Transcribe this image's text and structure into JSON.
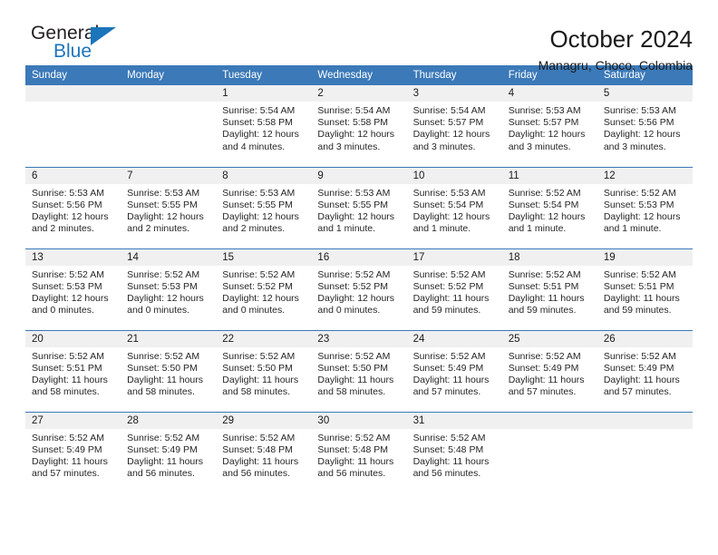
{
  "brand": {
    "word_general": "General",
    "word_blue": "Blue",
    "triangle_color": "#1b75bb"
  },
  "header": {
    "title": "October 2024",
    "subtitle": "Managru, Choco, Colombia",
    "accent_color": "#3b79b8"
  },
  "calendar": {
    "weekday_headers": [
      "Sunday",
      "Monday",
      "Tuesday",
      "Wednesday",
      "Thursday",
      "Friday",
      "Saturday"
    ],
    "labels": {
      "sunrise": "Sunrise:",
      "sunset": "Sunset:",
      "daylight": "Daylight:"
    },
    "weeks": [
      [
        {
          "day": "",
          "sunrise": "",
          "sunset": "",
          "daylight_line1": "",
          "daylight_line2": ""
        },
        {
          "day": "",
          "sunrise": "",
          "sunset": "",
          "daylight_line1": "",
          "daylight_line2": ""
        },
        {
          "day": "1",
          "sunrise": "Sunrise: 5:54 AM",
          "sunset": "Sunset: 5:58 PM",
          "daylight_line1": "Daylight: 12 hours",
          "daylight_line2": "and 4 minutes."
        },
        {
          "day": "2",
          "sunrise": "Sunrise: 5:54 AM",
          "sunset": "Sunset: 5:58 PM",
          "daylight_line1": "Daylight: 12 hours",
          "daylight_line2": "and 3 minutes."
        },
        {
          "day": "3",
          "sunrise": "Sunrise: 5:54 AM",
          "sunset": "Sunset: 5:57 PM",
          "daylight_line1": "Daylight: 12 hours",
          "daylight_line2": "and 3 minutes."
        },
        {
          "day": "4",
          "sunrise": "Sunrise: 5:53 AM",
          "sunset": "Sunset: 5:57 PM",
          "daylight_line1": "Daylight: 12 hours",
          "daylight_line2": "and 3 minutes."
        },
        {
          "day": "5",
          "sunrise": "Sunrise: 5:53 AM",
          "sunset": "Sunset: 5:56 PM",
          "daylight_line1": "Daylight: 12 hours",
          "daylight_line2": "and 3 minutes."
        }
      ],
      [
        {
          "day": "6",
          "sunrise": "Sunrise: 5:53 AM",
          "sunset": "Sunset: 5:56 PM",
          "daylight_line1": "Daylight: 12 hours",
          "daylight_line2": "and 2 minutes."
        },
        {
          "day": "7",
          "sunrise": "Sunrise: 5:53 AM",
          "sunset": "Sunset: 5:55 PM",
          "daylight_line1": "Daylight: 12 hours",
          "daylight_line2": "and 2 minutes."
        },
        {
          "day": "8",
          "sunrise": "Sunrise: 5:53 AM",
          "sunset": "Sunset: 5:55 PM",
          "daylight_line1": "Daylight: 12 hours",
          "daylight_line2": "and 2 minutes."
        },
        {
          "day": "9",
          "sunrise": "Sunrise: 5:53 AM",
          "sunset": "Sunset: 5:55 PM",
          "daylight_line1": "Daylight: 12 hours",
          "daylight_line2": "and 1 minute."
        },
        {
          "day": "10",
          "sunrise": "Sunrise: 5:53 AM",
          "sunset": "Sunset: 5:54 PM",
          "daylight_line1": "Daylight: 12 hours",
          "daylight_line2": "and 1 minute."
        },
        {
          "day": "11",
          "sunrise": "Sunrise: 5:52 AM",
          "sunset": "Sunset: 5:54 PM",
          "daylight_line1": "Daylight: 12 hours",
          "daylight_line2": "and 1 minute."
        },
        {
          "day": "12",
          "sunrise": "Sunrise: 5:52 AM",
          "sunset": "Sunset: 5:53 PM",
          "daylight_line1": "Daylight: 12 hours",
          "daylight_line2": "and 1 minute."
        }
      ],
      [
        {
          "day": "13",
          "sunrise": "Sunrise: 5:52 AM",
          "sunset": "Sunset: 5:53 PM",
          "daylight_line1": "Daylight: 12 hours",
          "daylight_line2": "and 0 minutes."
        },
        {
          "day": "14",
          "sunrise": "Sunrise: 5:52 AM",
          "sunset": "Sunset: 5:53 PM",
          "daylight_line1": "Daylight: 12 hours",
          "daylight_line2": "and 0 minutes."
        },
        {
          "day": "15",
          "sunrise": "Sunrise: 5:52 AM",
          "sunset": "Sunset: 5:52 PM",
          "daylight_line1": "Daylight: 12 hours",
          "daylight_line2": "and 0 minutes."
        },
        {
          "day": "16",
          "sunrise": "Sunrise: 5:52 AM",
          "sunset": "Sunset: 5:52 PM",
          "daylight_line1": "Daylight: 12 hours",
          "daylight_line2": "and 0 minutes."
        },
        {
          "day": "17",
          "sunrise": "Sunrise: 5:52 AM",
          "sunset": "Sunset: 5:52 PM",
          "daylight_line1": "Daylight: 11 hours",
          "daylight_line2": "and 59 minutes."
        },
        {
          "day": "18",
          "sunrise": "Sunrise: 5:52 AM",
          "sunset": "Sunset: 5:51 PM",
          "daylight_line1": "Daylight: 11 hours",
          "daylight_line2": "and 59 minutes."
        },
        {
          "day": "19",
          "sunrise": "Sunrise: 5:52 AM",
          "sunset": "Sunset: 5:51 PM",
          "daylight_line1": "Daylight: 11 hours",
          "daylight_line2": "and 59 minutes."
        }
      ],
      [
        {
          "day": "20",
          "sunrise": "Sunrise: 5:52 AM",
          "sunset": "Sunset: 5:51 PM",
          "daylight_line1": "Daylight: 11 hours",
          "daylight_line2": "and 58 minutes."
        },
        {
          "day": "21",
          "sunrise": "Sunrise: 5:52 AM",
          "sunset": "Sunset: 5:50 PM",
          "daylight_line1": "Daylight: 11 hours",
          "daylight_line2": "and 58 minutes."
        },
        {
          "day": "22",
          "sunrise": "Sunrise: 5:52 AM",
          "sunset": "Sunset: 5:50 PM",
          "daylight_line1": "Daylight: 11 hours",
          "daylight_line2": "and 58 minutes."
        },
        {
          "day": "23",
          "sunrise": "Sunrise: 5:52 AM",
          "sunset": "Sunset: 5:50 PM",
          "daylight_line1": "Daylight: 11 hours",
          "daylight_line2": "and 58 minutes."
        },
        {
          "day": "24",
          "sunrise": "Sunrise: 5:52 AM",
          "sunset": "Sunset: 5:49 PM",
          "daylight_line1": "Daylight: 11 hours",
          "daylight_line2": "and 57 minutes."
        },
        {
          "day": "25",
          "sunrise": "Sunrise: 5:52 AM",
          "sunset": "Sunset: 5:49 PM",
          "daylight_line1": "Daylight: 11 hours",
          "daylight_line2": "and 57 minutes."
        },
        {
          "day": "26",
          "sunrise": "Sunrise: 5:52 AM",
          "sunset": "Sunset: 5:49 PM",
          "daylight_line1": "Daylight: 11 hours",
          "daylight_line2": "and 57 minutes."
        }
      ],
      [
        {
          "day": "27",
          "sunrise": "Sunrise: 5:52 AM",
          "sunset": "Sunset: 5:49 PM",
          "daylight_line1": "Daylight: 11 hours",
          "daylight_line2": "and 57 minutes."
        },
        {
          "day": "28",
          "sunrise": "Sunrise: 5:52 AM",
          "sunset": "Sunset: 5:49 PM",
          "daylight_line1": "Daylight: 11 hours",
          "daylight_line2": "and 56 minutes."
        },
        {
          "day": "29",
          "sunrise": "Sunrise: 5:52 AM",
          "sunset": "Sunset: 5:48 PM",
          "daylight_line1": "Daylight: 11 hours",
          "daylight_line2": "and 56 minutes."
        },
        {
          "day": "30",
          "sunrise": "Sunrise: 5:52 AM",
          "sunset": "Sunset: 5:48 PM",
          "daylight_line1": "Daylight: 11 hours",
          "daylight_line2": "and 56 minutes."
        },
        {
          "day": "31",
          "sunrise": "Sunrise: 5:52 AM",
          "sunset": "Sunset: 5:48 PM",
          "daylight_line1": "Daylight: 11 hours",
          "daylight_line2": "and 56 minutes."
        },
        {
          "day": "",
          "sunrise": "",
          "sunset": "",
          "daylight_line1": "",
          "daylight_line2": ""
        },
        {
          "day": "",
          "sunrise": "",
          "sunset": "",
          "daylight_line1": "",
          "daylight_line2": ""
        }
      ]
    ]
  }
}
